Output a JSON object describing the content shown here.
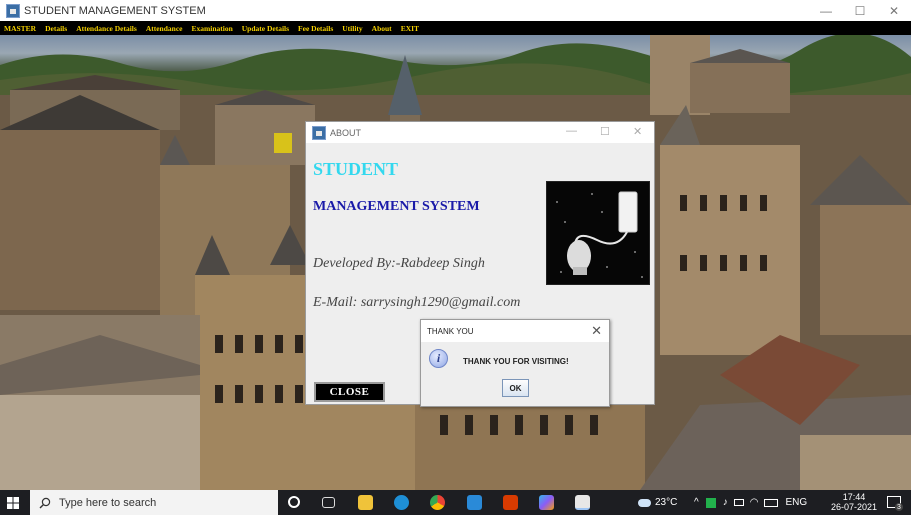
{
  "window": {
    "title": "STUDENT MANAGEMENT SYSTEM",
    "controls": {
      "minimize": "—",
      "maximize": "☐",
      "close": "✕"
    }
  },
  "menu": {
    "items": [
      "MASTER",
      "Details",
      "Attendance Details",
      "Attendance",
      "Examination",
      "Update Details",
      "Fee Details",
      "Utility",
      "About",
      "EXIT"
    ],
    "text_color": "#f5d100"
  },
  "about_dialog": {
    "title": "ABOUT",
    "heading1": "STUDENT",
    "heading2": "MANAGEMENT SYSTEM",
    "developer": "Developed By:-Rabdeep Singh",
    "email": "E-Mail: sarrysingh1290@gmail.com",
    "close_label": "CLOSE",
    "controls": {
      "minimize": "—",
      "maximize": "☐",
      "close": "✕"
    }
  },
  "thanks_dialog": {
    "title": "THANK YOU",
    "message": "THANK YOU FOR VISITING!",
    "ok_label": "OK",
    "icon": "info-icon"
  },
  "taskbar": {
    "search_placeholder": "Type here to search",
    "weather": "23°C",
    "language": "ENG",
    "time": "17:44",
    "date": "26-07-2021",
    "notification_count": "3"
  }
}
